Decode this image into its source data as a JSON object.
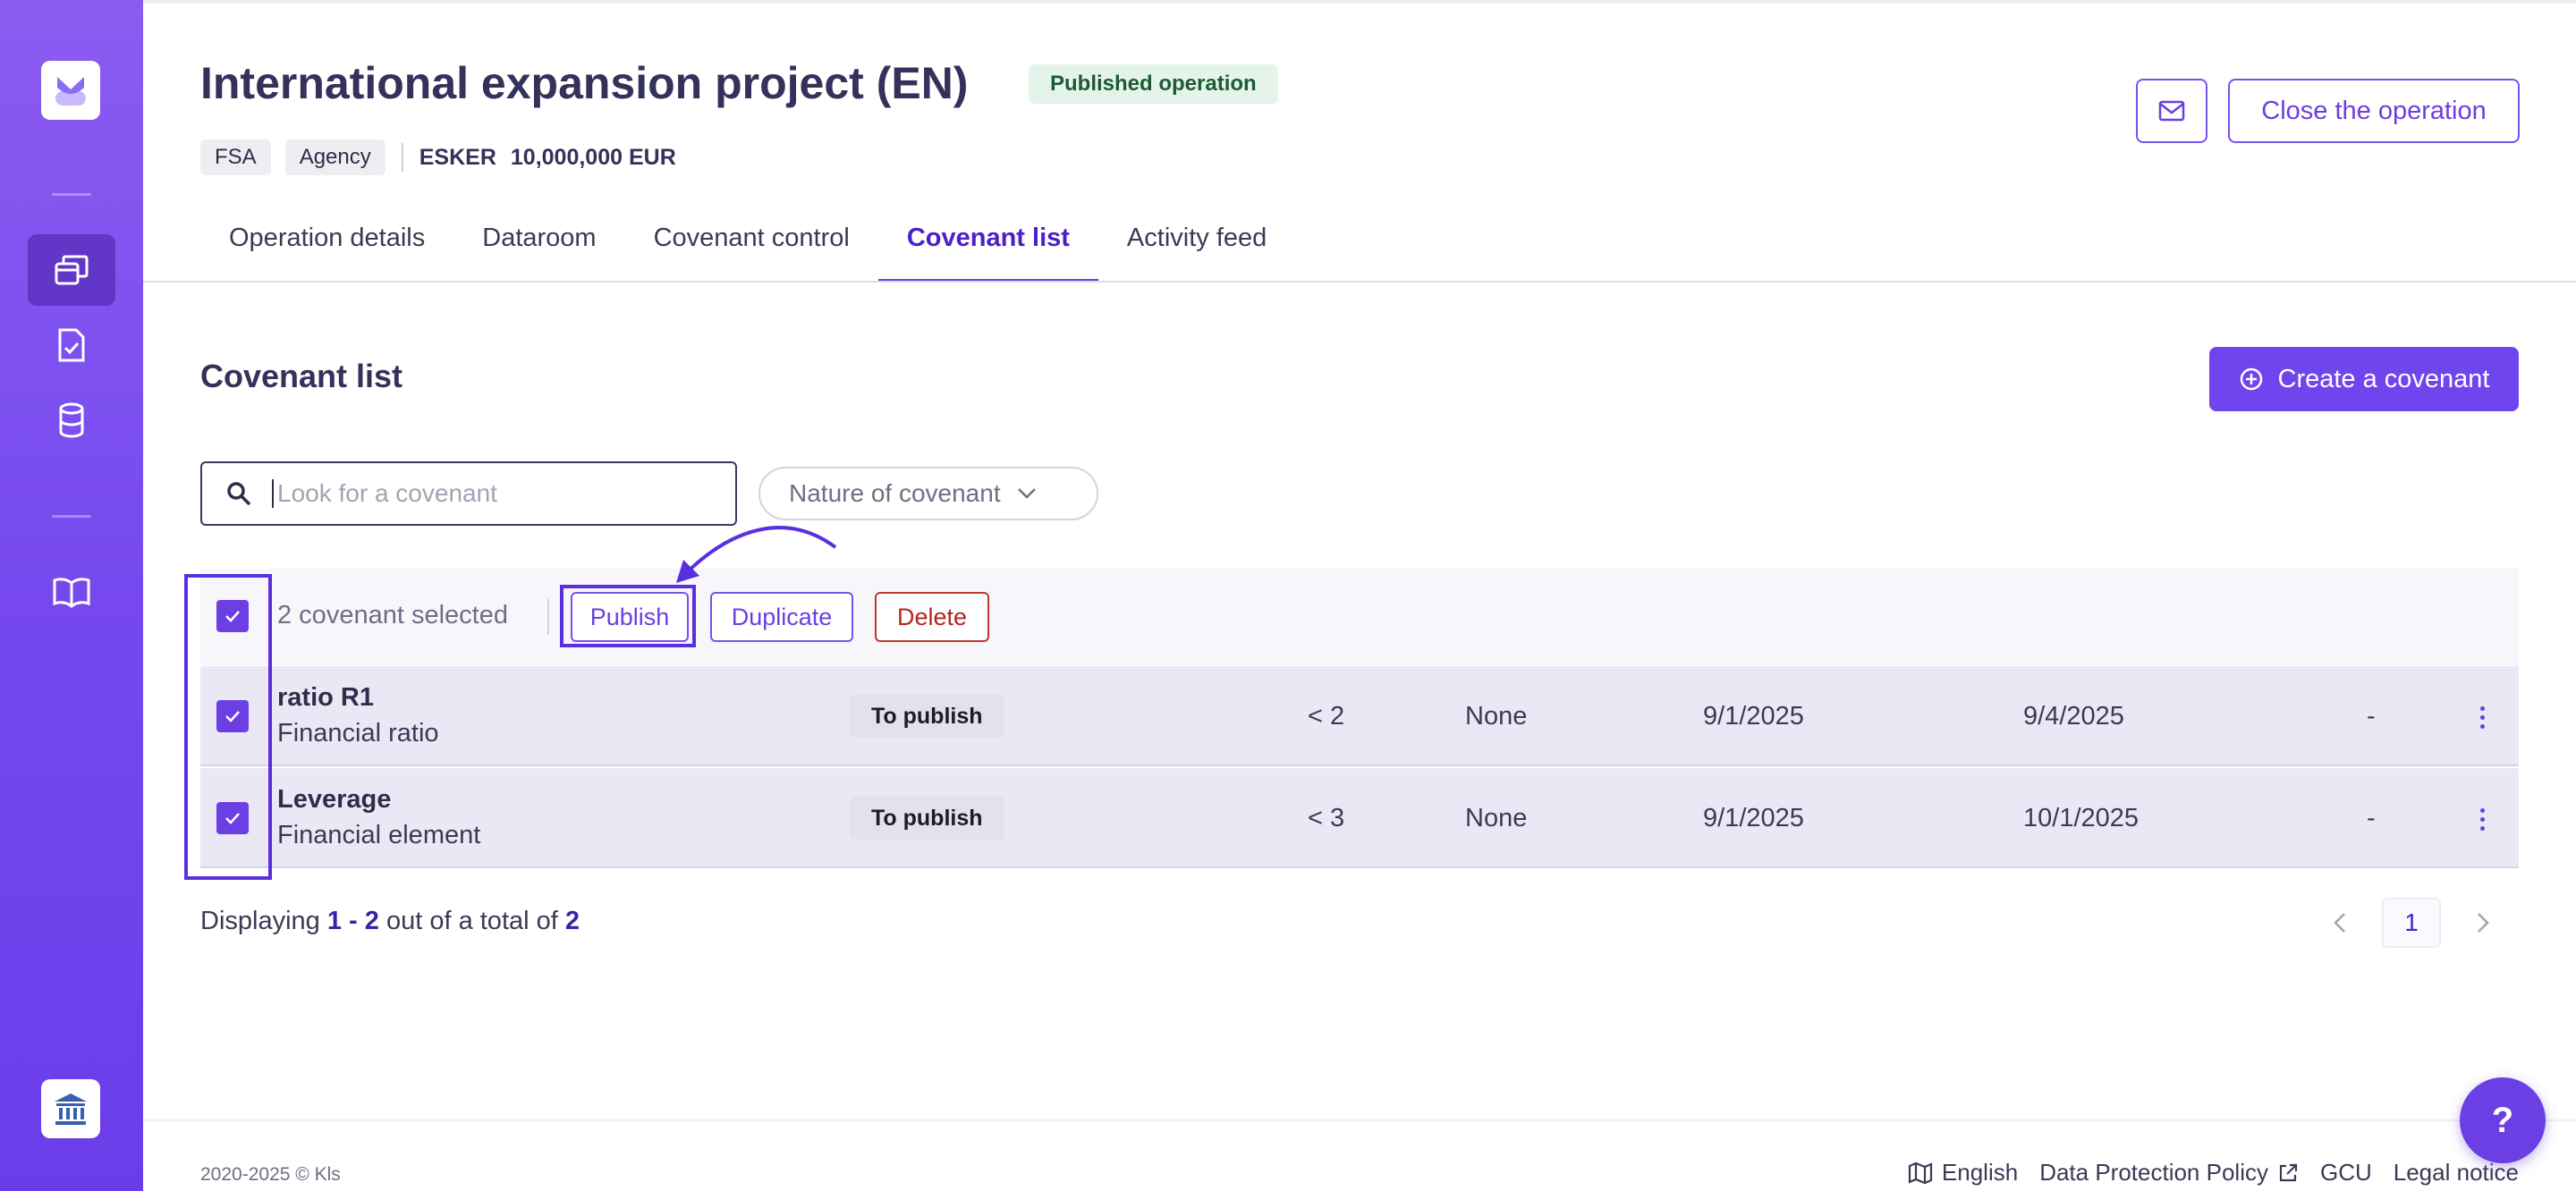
{
  "header": {
    "title": "International expansion project (EN)",
    "status": "Published operation",
    "tags": [
      "FSA",
      "Agency"
    ],
    "company": "ESKER",
    "amount": "10,000,000 EUR",
    "close_label": "Close the operation"
  },
  "tabs": [
    {
      "label": "Operation details",
      "active": false
    },
    {
      "label": "Dataroom",
      "active": false
    },
    {
      "label": "Covenant control",
      "active": false
    },
    {
      "label": "Covenant list",
      "active": true
    },
    {
      "label": "Activity feed",
      "active": false
    }
  ],
  "section": {
    "title": "Covenant list",
    "create_label": "Create a covenant"
  },
  "search": {
    "placeholder": "Look for a covenant",
    "value": ""
  },
  "filter": {
    "label": "Nature of covenant"
  },
  "toolbar": {
    "selected_text": "2 covenant selected",
    "publish": "Publish",
    "duplicate": "Duplicate",
    "delete": "Delete"
  },
  "rows": [
    {
      "name": "ratio R1",
      "type": "Financial ratio",
      "status": "To publish",
      "threshold": "< 2",
      "tolerance": "None",
      "start": "9/1/2025",
      "next": "9/4/2025",
      "extra": "-",
      "checked": true
    },
    {
      "name": "Leverage",
      "type": "Financial element",
      "status": "To publish",
      "threshold": "< 3",
      "tolerance": "None",
      "start": "9/1/2025",
      "next": "10/1/2025",
      "extra": "-",
      "checked": true
    }
  ],
  "pagination": {
    "prefix": "Displaying",
    "range": "1 - 2",
    "middle": "out of a total of",
    "total": "2",
    "current_page": "1"
  },
  "footer": {
    "copyright": "2020-2025 © Kls",
    "language": "English",
    "privacy": "Data Protection Policy",
    "gcu": "GCU",
    "legal": "Legal notice"
  },
  "help": {
    "label": "?"
  },
  "colors": {
    "accent": "#6b3fe3",
    "sidebar": "#7447ee",
    "status_bg": "#e5f4ea",
    "delete": "#b3261e"
  }
}
